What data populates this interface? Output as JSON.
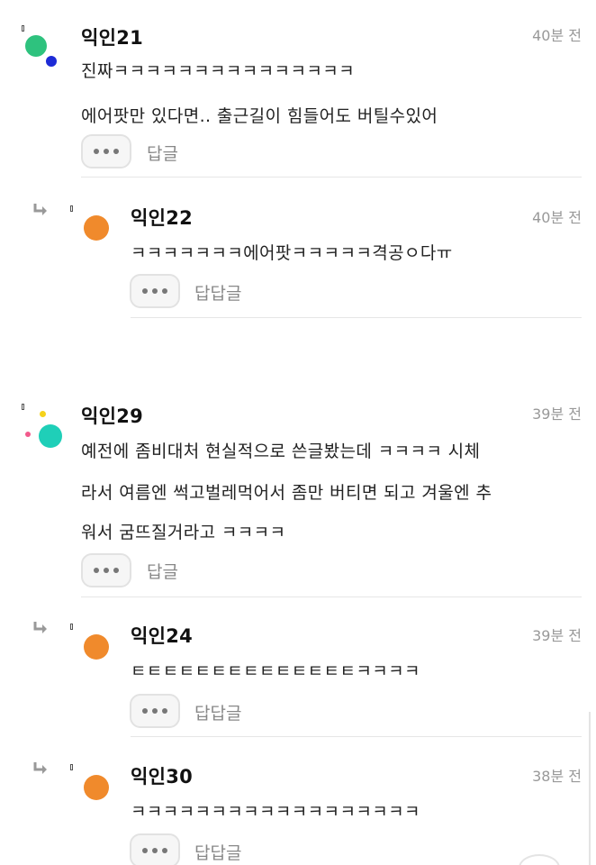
{
  "comments": [
    {
      "author": "익인21",
      "time": "40분 전",
      "lines": [
        "진짜ㅋㅋㅋㅋㅋㅋㅋㅋㅋㅋㅋㅋㅋㅋㅋ",
        "에어팟만 있다면.. 출근길이 힘들어도 버틸수있어"
      ],
      "reply_label": "답글",
      "avatar_color": "#2ec27e",
      "accent_color": "#1d2bd6"
    },
    {
      "author": "익인22",
      "time": "40분 전",
      "lines": [
        "ㅋㅋㅋㅋㅋㅋㅋ에어팟ㅋㅋㅋㅋㅋ격공ㅇ다ㅠ"
      ],
      "reply_label": "답답글",
      "avatar_color": "#f08a2c"
    },
    {
      "author": "익인29",
      "time": "39분 전",
      "lines": [
        "예전에 좀비대처 현실적으로 쓴글봤는데 ㅋㅋㅋㅋ 시체",
        "라서 여름엔 썩고벌레먹어서 좀만 버티면 되고 겨울엔 추",
        "워서 굼뜨질거라고 ㅋㅋㅋㅋ"
      ],
      "reply_label": "답글",
      "avatar_color": "#1fcfb8",
      "accent_color": "#f5d21b",
      "accent_color_2": "#f25a8c"
    },
    {
      "author": "익인24",
      "time": "39분 전",
      "lines": [
        "ㅌㅌㅌㅌㅌㅌㅌㅌㅌㅌㅌㅌㅌㅌㅋㅋㅋㅋ"
      ],
      "reply_label": "답답글",
      "avatar_color": "#f08a2c"
    },
    {
      "author": "익인30",
      "time": "38분 전",
      "lines": [
        "ㅋㅋㅋㅋㅋㅋㅋㅋㅋㅋㅋㅋㅋㅋㅋㅋㅋㅋ"
      ],
      "reply_label": "답답글",
      "avatar_color": "#f08a2c"
    }
  ]
}
